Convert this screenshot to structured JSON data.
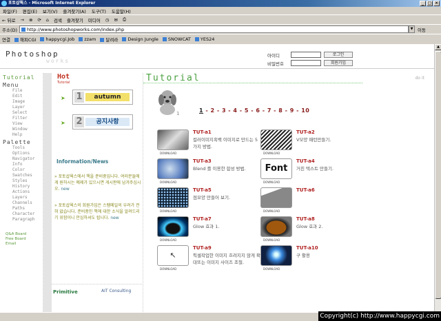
{
  "window": {
    "title": "포토샵웍스 - Microsoft Internet Explorer",
    "buttons": [
      "_",
      "□",
      "×"
    ]
  },
  "menubar": [
    "파일(F)",
    "편집(E)",
    "보기(V)",
    "즐겨찾기(A)",
    "도구(T)",
    "도움말(H)"
  ],
  "toolbar": {
    "back": "← 뒤로",
    "forward": "→",
    "search": "검색",
    "favorites": "즐겨찾기",
    "media": "미디어"
  },
  "address": {
    "label": "주소(D)",
    "url": "http://www.photoshopworks.com/index.php",
    "go": "이동"
  },
  "links": {
    "label": "연결",
    "items": [
      "해피CGI",
      "happycgi.Job",
      "zzam",
      "달려라",
      "Design Jungle",
      "SNOWCAT",
      "YES24"
    ]
  },
  "site": {
    "logo_main": "Photoshop",
    "logo_sub": "works",
    "login": {
      "id_label": "아이디",
      "pw_label": "비밀번호",
      "login_btn": "로그인",
      "join_btn": "회원가입"
    }
  },
  "sidebar": {
    "tutorial": "Tutorial",
    "menu_title": "Menu",
    "menu_items": [
      "File",
      "Edit",
      "Image",
      "Layer",
      "Select",
      "Filter",
      "View",
      "Window",
      "Help"
    ],
    "palette_title": "Palette",
    "palette_items": [
      "Tools",
      "Options",
      "Navigator",
      "Info",
      "Color",
      "Swatches",
      "Styles",
      "History",
      "Actions",
      "Layers",
      "Channels",
      "Paths",
      "Character",
      "Paragraph"
    ],
    "links": [
      "Q&A Board",
      "Free Board",
      "Email"
    ]
  },
  "hot": {
    "title": "Hot",
    "sub": "Tutorial",
    "banners": [
      {
        "num": "1",
        "text": "autumn"
      },
      {
        "num": "2",
        "text": "공지사항"
      }
    ],
    "info_title": "Information/News",
    "news": [
      {
        "text": "포토샵웍스에서 책을 준비중입니다. 여러분들에게 원하시는 예제가 있으시면 게시판에 남겨주십시오.",
        "tag": "new"
      },
      {
        "text": "포토샵웍스의 회원가입은 스펨메일의 우려가 전혀 없습니다. 준비중인 책에 대한 소식을 알려드리기 위함이니 안심하셔도 됩니다.",
        "tag": "new"
      }
    ],
    "partners": [
      "Primitive",
      "AIT Consulting"
    ]
  },
  "main": {
    "title": "Tutorial",
    "doit": "do it",
    "pager": [
      "1",
      "2",
      "3",
      "4",
      "5",
      "6",
      "7",
      "8",
      "9",
      "10"
    ],
    "download_label": "DOWNLOAD",
    "items": [
      {
        "code": "TUT-a1",
        "desc": "컬러이미지흑백 이미지로 만드는 5가지 방법."
      },
      {
        "code": "TUT-a2",
        "desc": "V모양 패턴만들기."
      },
      {
        "code": "TUT-a3",
        "desc": "Blend 를 이용한 합성 방법."
      },
      {
        "code": "TUT-a4",
        "desc": "거친 텍스트 만들기."
      },
      {
        "code": "TUT-a5",
        "desc": "점모양 만들어 보기."
      },
      {
        "code": "TUT-a6",
        "desc": ""
      },
      {
        "code": "TUT-a7",
        "desc": "Glow 효과 1."
      },
      {
        "code": "TUT-a8",
        "desc": "Glow 효과 2."
      },
      {
        "code": "TUT-a9",
        "desc": "픽셀작업한 이미지 흐려지지 않게 확대또는 이미지 사이즈 조절."
      },
      {
        "code": "TUT-a10",
        "desc": "구 활용"
      }
    ],
    "thumb_texts": {
      "a4": "Font"
    }
  },
  "footer": {
    "copyright": "Copyright(c) http://www.happycgi.com"
  }
}
